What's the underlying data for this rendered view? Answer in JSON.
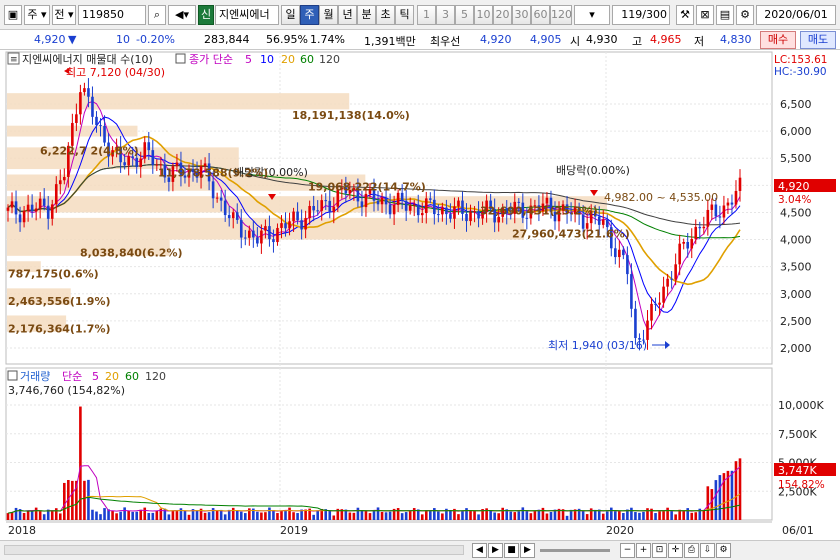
{
  "toolbar": {
    "market_label": "주",
    "prev_label": "전",
    "code": "119850",
    "badge": "신",
    "stock_name": "지엔씨에너",
    "periods": [
      "일",
      "주",
      "월",
      "년",
      "분",
      "초",
      "틱"
    ],
    "active_period": "주",
    "intervals": [
      "1",
      "3",
      "5",
      "10",
      "20",
      "30",
      "60",
      "120"
    ],
    "count": "119",
    "count_total": "/300",
    "date": "2020/06/01"
  },
  "quote": {
    "price": "4,920",
    "change": "10",
    "change_pct": "-0.20%",
    "volume": "283,844",
    "turnover_pct": "56.95%",
    "pct2": "1.74%",
    "amount": "1,391백만",
    "bid_label": "최우선",
    "bid1": "4,920",
    "bid2": "4,905",
    "open_label": "시",
    "open": "4,930",
    "high_label": "고",
    "high": "4,965",
    "low_label": "저",
    "low": "4,830",
    "buy_label": "매수",
    "sell_label": "매도"
  },
  "price_panel": {
    "title": "지엔씨에너지 매물대 수(10)",
    "ma_title": "종가 단순",
    "ma_periods": [
      "5",
      "10",
      "20",
      "60",
      "120"
    ],
    "lc_label": "LC:153.61",
    "hc_label": "HC:-30.90",
    "current_price": "4,920",
    "current_pct": "3.04%",
    "max_label": "최고 7,120 (04/30)",
    "min_label": "최저 1,940 (03/16)",
    "dividend_labels": [
      "배당락(0.00%)",
      "배당락(0.00%)",
      "배당락(0.00%)"
    ],
    "range_label": "4,982.00 ~ 4,535.00",
    "volume_profile_labels": [
      "18,191,138(14.0%)",
      "6,222,7 2(4.8%)",
      "11,978,588(9.2%)",
      "19,068,222(14.7%)",
      "32,690,431(25.2%)",
      "27,960,473(21.6%)",
      "8,038,840(6.2%)",
      "787,175(0.6%)",
      "2,463,556(1.9%)",
      "2,176,364(1.7%)"
    ],
    "y_ticks": [
      "6,500",
      "6,000",
      "5,500",
      "5,000",
      "4,500",
      "4,000",
      "3,500",
      "3,000",
      "2,500",
      "2,000"
    ]
  },
  "volume_panel": {
    "title": "거래량",
    "ma_title": "단순",
    "ma_periods": [
      "5",
      "20",
      "60",
      "120"
    ],
    "max_label": "3,746,760 (154,82%)",
    "current_volume": "3,747K",
    "current_pct": "154.82%",
    "y_ticks": [
      "10,000K",
      "7,500K",
      "5,000K",
      "2,500K"
    ]
  },
  "x_axis": {
    "labels": [
      "2018",
      "2019",
      "2020",
      "06/01"
    ]
  },
  "colors": {
    "up": "#e00000",
    "down": "#1a3fd0",
    "profile": "#f5dcc0",
    "profile_text": "#7a4a12",
    "ma5": "#c000c0",
    "ma10": "#0000ff",
    "ma20": "#e0a000",
    "ma60": "#008000",
    "ma120": "#404040"
  },
  "chart_data": {
    "type": "candlestick",
    "note": "weekly OHLC (approx) from 2018 to 2020/06/01",
    "x": [
      "2018",
      "2019",
      "2020"
    ],
    "ylim": [
      1900,
      6900
    ],
    "candles": [],
    "volume": []
  }
}
